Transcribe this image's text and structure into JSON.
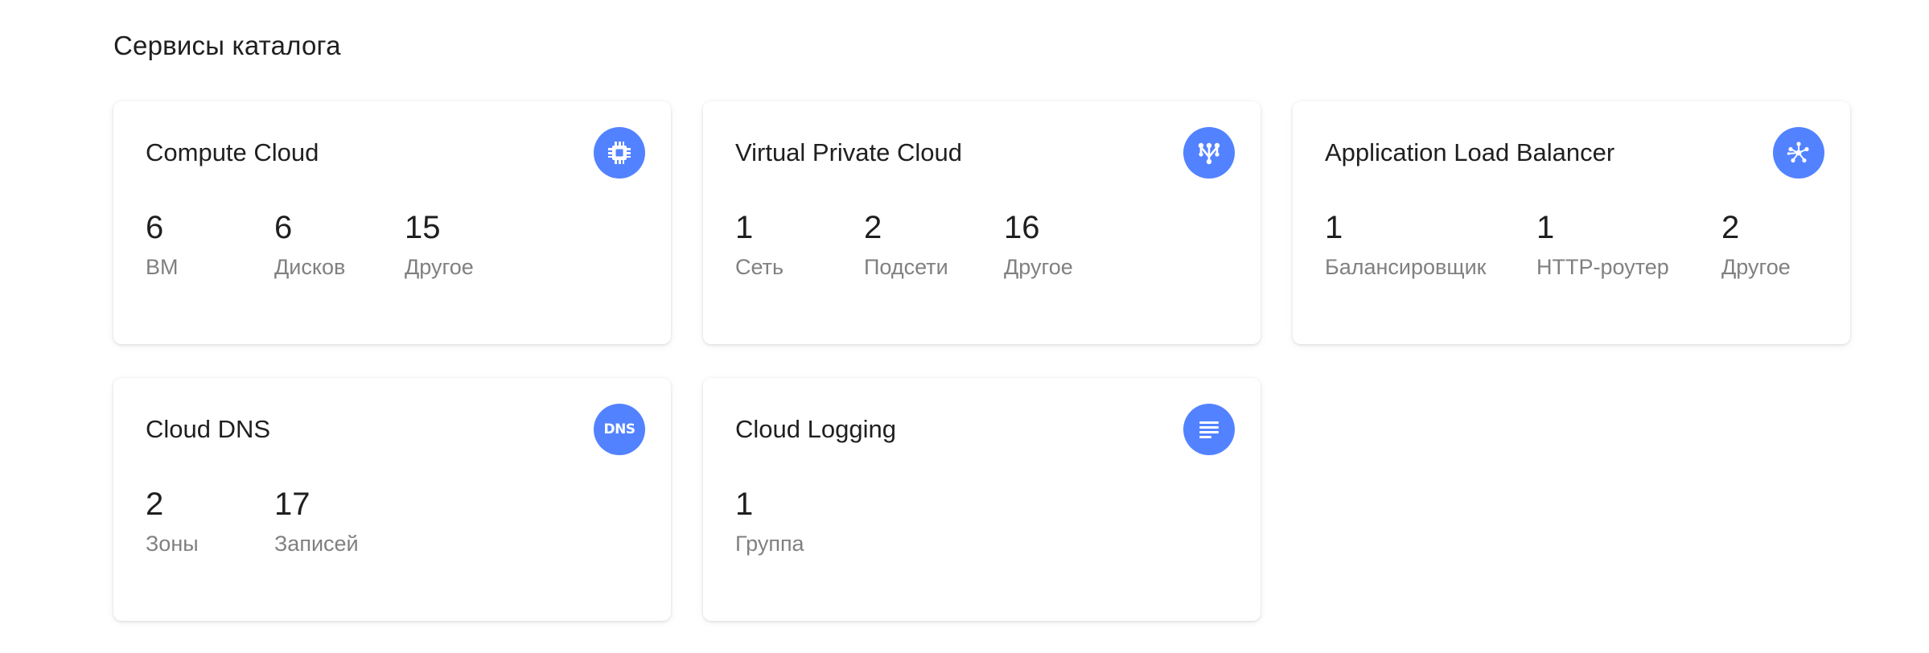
{
  "page": {
    "title": "Сервисы каталога"
  },
  "theme": {
    "accent": "#5282ff",
    "label_color": "#808080",
    "text_color": "#1f1f1f"
  },
  "cards": [
    {
      "title": "Compute Cloud",
      "icon": "chip-icon",
      "stats": [
        {
          "value": "6",
          "label": "ВМ"
        },
        {
          "value": "6",
          "label": "Дисков"
        },
        {
          "value": "15",
          "label": "Другое"
        }
      ]
    },
    {
      "title": "Virtual Private Cloud",
      "icon": "network-icon",
      "stats": [
        {
          "value": "1",
          "label": "Сеть"
        },
        {
          "value": "2",
          "label": "Подсети"
        },
        {
          "value": "16",
          "label": "Другое"
        }
      ]
    },
    {
      "title": "Application Load Balancer",
      "icon": "balancer-icon",
      "stats": [
        {
          "value": "1",
          "label": "Балансировщик"
        },
        {
          "value": "1",
          "label": "HTTP-роутер"
        },
        {
          "value": "2",
          "label": "Другое"
        }
      ]
    },
    {
      "title": "Cloud DNS",
      "icon": "dns-icon",
      "icon_text": "DNS",
      "stats": [
        {
          "value": "2",
          "label": "Зоны"
        },
        {
          "value": "17",
          "label": "Записей"
        }
      ]
    },
    {
      "title": "Cloud Logging",
      "icon": "log-lines-icon",
      "stats": [
        {
          "value": "1",
          "label": "Группа"
        }
      ]
    }
  ]
}
